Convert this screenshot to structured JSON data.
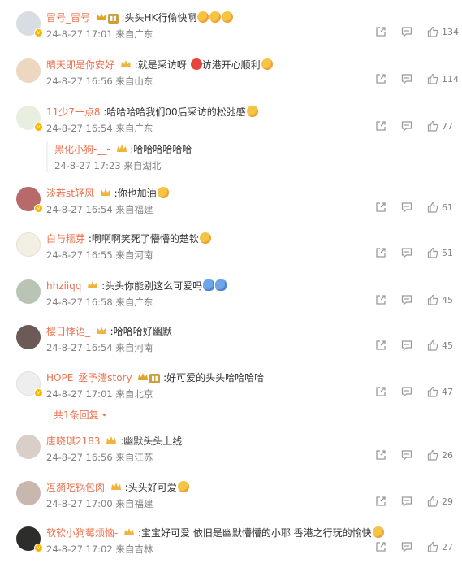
{
  "comments": [
    {
      "name": "冒号_冒号",
      "text": "头头HK行偷快啊",
      "time": "24-8-27 17:01",
      "location": "来自广东",
      "likes": "134",
      "avatar_color": "#d8dde3"
    },
    {
      "name": "晴天即是你安好",
      "text": "就是采访呀",
      "text2": "访港开心顺利",
      "time": "24-8-27 16:56",
      "location": "来自山东",
      "likes": "114",
      "avatar_color": "#ecd7c0"
    },
    {
      "name": "11少7一点8",
      "text": "哈哈哈哈我们00后采访的松弛感",
      "time": "24-8-27 16:54",
      "location": "来自广东",
      "likes": "77",
      "avatar_color": "#e8eee0"
    },
    {
      "name": "淡若st轻风",
      "text": "你也加油",
      "time": "24-8-27 16:54",
      "location": "来自福建",
      "likes": "61",
      "avatar_color": "#b86a6a"
    },
    {
      "name": "白与糯芽",
      "text": "啊啊啊笑死了懵懵的楚钦",
      "time": "24-8-27 16:55",
      "location": "来自河南",
      "likes": "51",
      "avatar_color": "#f3efe2"
    },
    {
      "name": "hhziiqq",
      "text": "头头你能别这么可爱吗",
      "time": "24-8-27 16:58",
      "location": "来自广东",
      "likes": "45",
      "avatar_color": "#b9c4b5"
    },
    {
      "name": "樱日悸语_",
      "text": "哈哈哈好幽默",
      "time": "24-8-27 16:54",
      "location": "来自河南",
      "likes": "45",
      "avatar_color": "#6b5a55"
    },
    {
      "name": "HOPE_丞予濇story",
      "text": "好可爱的头头哈哈哈哈",
      "time": "24-8-27 17:01",
      "location": "来自北京",
      "likes": "47",
      "avatar_color": "#eeeeee"
    },
    {
      "name": "唐晓琪2183",
      "text": "幽默头头上线",
      "time": "24-8-27 16:56",
      "location": "来自江苏",
      "likes": "26",
      "avatar_color": "#d9cfc8"
    },
    {
      "name": "冱漪吃锅包肉",
      "text": "头头好可爱",
      "time": "24-8-27 17:00",
      "location": "来自福建",
      "likes": "29",
      "avatar_color": "#c8b7ad"
    },
    {
      "name": "软软小狗莓烦恼-",
      "text": "宝宝好可爱 依旧是幽默懵懵的小耶 香港之行玩的愉快",
      "time": "24-8-27 17:02",
      "location": "来自吉林",
      "likes": "27",
      "avatar_color": "#2d2e2b"
    }
  ],
  "reply": {
    "name": "黑化小狗-__-",
    "text": "哈哈哈哈哈哈",
    "time": "24-8-27 17:23",
    "location": "来自湖北"
  },
  "more_replies": "共1条回复",
  "colors": {
    "username": "#eb7350",
    "meta": "#808080",
    "accent_emoji": "#f6c445"
  },
  "icons": [
    "share-icon",
    "comment-icon",
    "like-icon",
    "crown-icon",
    "verified-icon",
    "emoji-icon",
    "chevron-down-icon"
  ]
}
